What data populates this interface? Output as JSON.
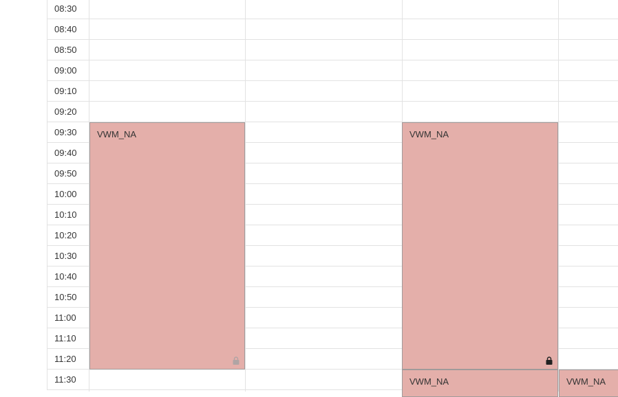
{
  "time_slots": [
    "08:30",
    "08:40",
    "08:50",
    "09:00",
    "09:10",
    "09:20",
    "09:30",
    "09:40",
    "09:50",
    "10:00",
    "10:10",
    "10:20",
    "10:30",
    "10:40",
    "10:50",
    "11:00",
    "11:10",
    "11:20",
    "11:30"
  ],
  "events": [
    {
      "title": "VWM_NA",
      "start": "09:30",
      "end": "11:30",
      "column": 1,
      "lock": "lock-icon",
      "lock_color": "#b0a4a4"
    },
    {
      "title": "VWM_NA",
      "start": "09:30",
      "end": "11:30",
      "column": 3,
      "lock": "lock-icon",
      "lock_color": "#222222"
    },
    {
      "title": "VWM_NA",
      "start": "11:30",
      "column": 3
    },
    {
      "title": "VWM_NA",
      "start": "11:30",
      "column": 4
    }
  ],
  "colors": {
    "event_bg": "#e4afaa",
    "grid_line": "#e2e2e2"
  }
}
